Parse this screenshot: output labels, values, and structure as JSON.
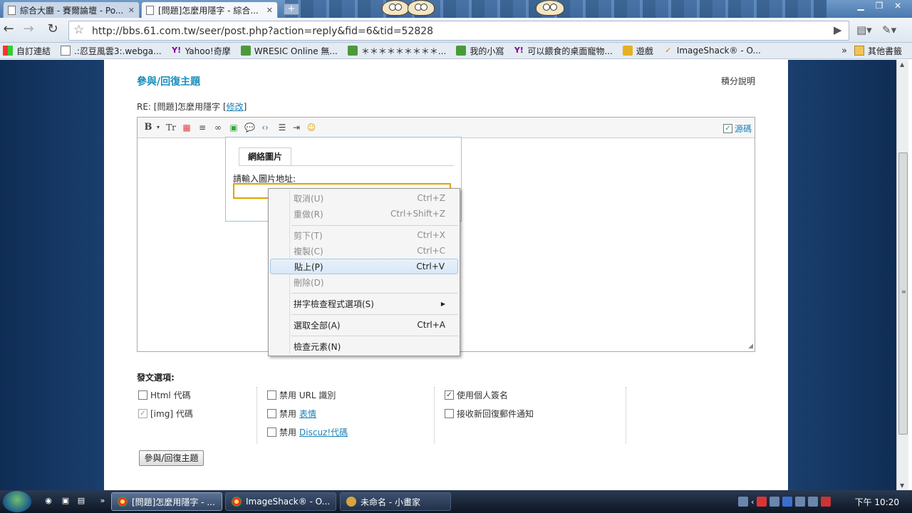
{
  "browser": {
    "tabs": [
      {
        "title": "綜合大廳 - 賽爾論壇 - Po..."
      },
      {
        "title": "[問題]怎麼用隱字 - 綜合..."
      }
    ],
    "new_tab_label": "+",
    "url": "http://bbs.61.com.tw/seer/post.php?action=reply&fid=6&tid=52828"
  },
  "bookmarks": [
    {
      "label": "自訂連結",
      "icon": "windows-icon"
    },
    {
      "label": ".:忍豆風雲3:.webga...",
      "icon": "page-icon"
    },
    {
      "label": "Yahoo!奇摩",
      "icon": "yahoo-icon"
    },
    {
      "label": "WRESIC Online 無...",
      "icon": "green-icon"
    },
    {
      "label": "＊＊＊＊＊＊＊＊＊...",
      "icon": "green-icon"
    },
    {
      "label": "我的小窩",
      "icon": "green-icon"
    },
    {
      "label": "可以餵食的桌面寵物...",
      "icon": "yahoo-icon"
    },
    {
      "label": "遊戲",
      "icon": "gold-icon"
    },
    {
      "label": "ImageShack® - O...",
      "icon": "imageshack-icon"
    }
  ],
  "bookmarks_more": "»",
  "bookmarks_other": "其他書籤",
  "page": {
    "heading": "參與/回復主題",
    "credits_link": "積分說明",
    "subject_prefix": "RE: [問題]怎麼用隱字 [",
    "subject_edit": "修改",
    "subject_suffix": "]",
    "source_label": "源碼",
    "image_dialog": {
      "tab": "網絡圖片",
      "label": "請輸入圖片地址:"
    },
    "options_title": "發文選項:",
    "options": {
      "html": "Html 代碼",
      "img": "[img] 代碼",
      "disable_url": "禁用 URL 識別",
      "disable_smilies_prefix": "禁用",
      "disable_smilies_link": "表情",
      "disable_discuz_prefix": "禁用",
      "disable_discuz_link": "Discuz!代碼",
      "use_signature": "使用個人簽名",
      "email_notify": "接收新回復郵件通知"
    },
    "submit_label": "參與/回復主題"
  },
  "context_menu": [
    {
      "label": "取消(U)",
      "shortcut": "Ctrl+Z",
      "disabled": true
    },
    {
      "label": "重做(R)",
      "shortcut": "Ctrl+Shift+Z",
      "disabled": true
    },
    {
      "label": "剪下(T)",
      "shortcut": "Ctrl+X",
      "disabled": true
    },
    {
      "label": "複製(C)",
      "shortcut": "Ctrl+C",
      "disabled": true
    },
    {
      "label": "貼上(P)",
      "shortcut": "Ctrl+V",
      "disabled": false
    },
    {
      "label": "刪除(D)",
      "shortcut": "",
      "disabled": true
    },
    {
      "label": "拼字檢查程式選項(S)",
      "shortcut": "",
      "disabled": false
    },
    {
      "label": "選取全部(A)",
      "shortcut": "Ctrl+A",
      "disabled": false
    },
    {
      "label": "檢查元素(N)",
      "shortcut": "",
      "disabled": false
    }
  ],
  "taskbar": {
    "tasks": [
      {
        "title": "[問題]怎麼用隱字 - ..."
      },
      {
        "title": "ImageShack® - O..."
      },
      {
        "title": "未命名 - 小畫家"
      }
    ],
    "quicklaunch_more": "»",
    "clock": "下午 10:20"
  }
}
